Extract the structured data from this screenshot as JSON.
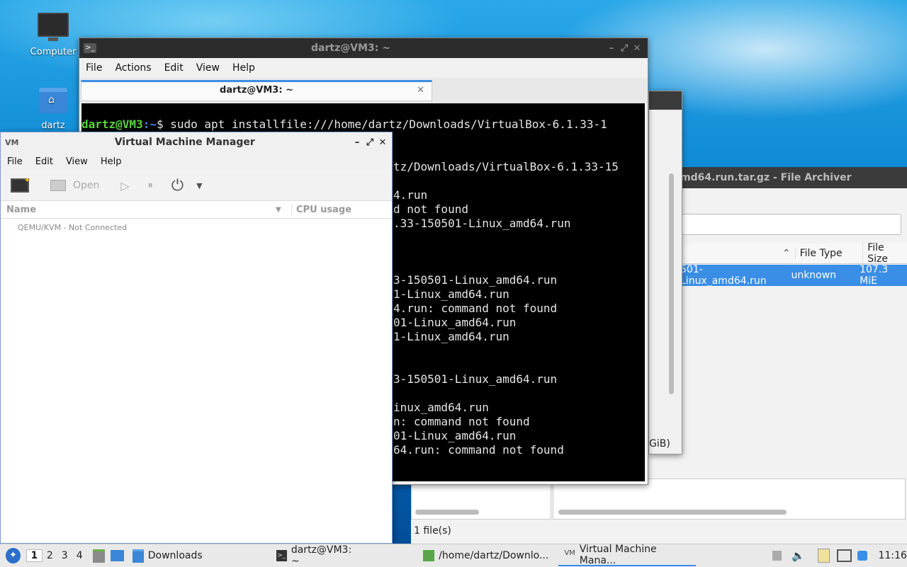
{
  "desktop": {
    "icons": [
      {
        "label": "Computer"
      },
      {
        "label": "dartz"
      }
    ]
  },
  "file_archiver": {
    "title": "md64.run.tar.gz - File Archiver",
    "columns": [
      "File Type",
      "File Size"
    ],
    "row": {
      "name": "501-Linux_amd64.run",
      "type": "unknown",
      "size": "107.3 MiE"
    },
    "status": "1 file(s)",
    "side_text": "GiB)"
  },
  "terminal": {
    "title": "dartz@VM3: ~",
    "menu": [
      "File",
      "Actions",
      "Edit",
      "View",
      "Help"
    ],
    "tab_label": "dartz@VM3: ~",
    "prompt_user": "dartz@VM3",
    "prompt_path": ":~",
    "prompt_symbol": "$",
    "command": " sudo apt installfile:///home/dartz/Downloads/VirtualBox-6.1.33-1",
    "lines": [
      "tz/Downloads/VirtualBox-6.1.33-15",
      "4.run",
      "d not found",
      ".33-150501-Linux_amd64.run",
      "3-150501-Linux_amd64.run",
      "1-Linux_amd64.run",
      "4.run: command not found",
      "01-Linux_amd64.run",
      "1-Linux_amd64.run",
      "3-150501-Linux_amd64.run",
      "inux_amd64.run",
      "n: command not found",
      "01-Linux_amd64.run",
      "64.run: command not found"
    ]
  },
  "vmm": {
    "title": "Virtual Machine Manager",
    "menu": [
      "File",
      "Edit",
      "View",
      "Help"
    ],
    "toolbar": {
      "open_label": "Open"
    },
    "columns": {
      "name": "Name",
      "cpu": "CPU usage"
    },
    "connection": "QEMU/KVM - Not Connected"
  },
  "taskbar": {
    "workspaces": [
      "1",
      "2",
      "3",
      "4"
    ],
    "tasks": [
      {
        "label": "Downloads"
      },
      {
        "label": "dartz@VM3: ~"
      },
      {
        "label": "/home/dartz/Downlo..."
      },
      {
        "label": "Virtual Machine Mana..."
      }
    ],
    "clock": "11:16"
  },
  "colors": {
    "accent": "#3a8ee6",
    "prompt_user": "#59d43a",
    "prompt_path": "#3c87e6",
    "selection": "#3a8ee6"
  }
}
